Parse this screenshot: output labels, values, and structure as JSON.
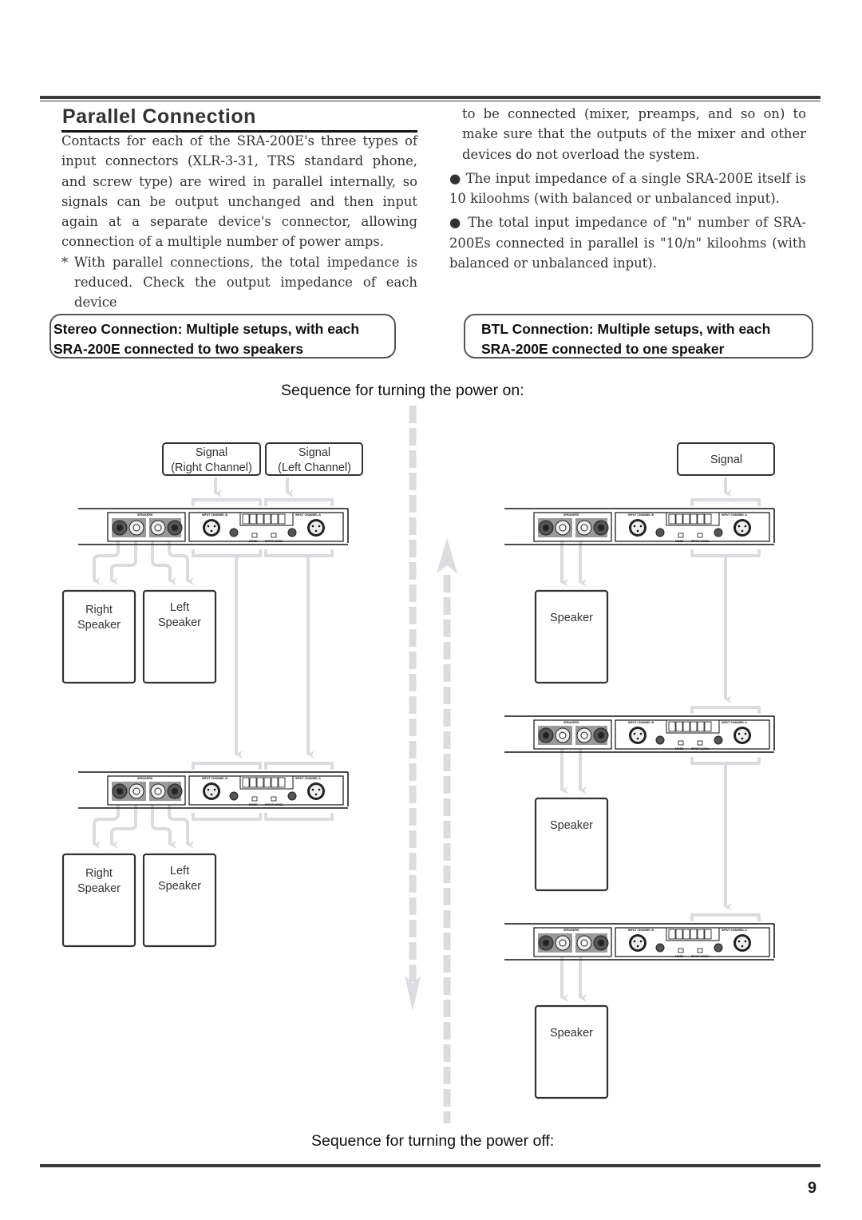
{
  "page": {
    "title": "Parallel Connection",
    "page_number": "9"
  },
  "left_column": {
    "paragraph": "Contacts for each of the SRA-200E's three types of input connectors (XLR-3-31, TRS standard phone, and screw type) are wired in parallel internally, so signals can be output unchanged and then input again at a separate device's connector, allowing connection of a multiple number of power amps.",
    "note_marker": "*",
    "note": "With parallel connections, the total impedance is reduced. Check the output impedance of each device"
  },
  "right_column": {
    "note_continued": "to be connected (mixer, preamps, and so on) to make sure that the outputs of the mixer and other devices do not overload the system.",
    "bullets": [
      "The input impedance of a single SRA-200E itself is 10 kiloohms (with balanced or unbalanced input).",
      "The total input impedance of \"n\" number of SRA-200Es connected in parallel is \"10/n\" kiloohms (with balanced or unbalanced input)."
    ],
    "bullet_glyph": "●"
  },
  "sections": {
    "stereo": {
      "line1": "Stereo Connection: Multiple setups, with each",
      "line2": "SRA-200E connected to two speakers"
    },
    "btl": {
      "line1": "BTL Connection: Multiple setups, with each",
      "line2": "SRA-200E connected to one speaker"
    }
  },
  "sequence": {
    "power_on": "Sequence for turning the power on:",
    "power_off": "Sequence for turning the power off:"
  },
  "diagram": {
    "stereo": {
      "signal_right": [
        "Signal",
        "(Right Channel)"
      ],
      "signal_left": [
        "Signal",
        "(Left Channel)"
      ],
      "speaker_right": [
        "Right",
        "Speaker"
      ],
      "speaker_left": [
        "Left",
        "Speaker"
      ]
    },
    "btl": {
      "signal": "Signal",
      "speaker": "Speaker"
    },
    "amp_panel": {
      "speakers_label": "SPEAKERS",
      "input_b": "INPUT CHANNEL B",
      "input_a": "INPUT CHANNEL A",
      "mode": "MODE",
      "input_level": "INPUT LEVEL"
    },
    "colors": {
      "arrow": "#dcdce0",
      "outline": "#333333"
    }
  }
}
